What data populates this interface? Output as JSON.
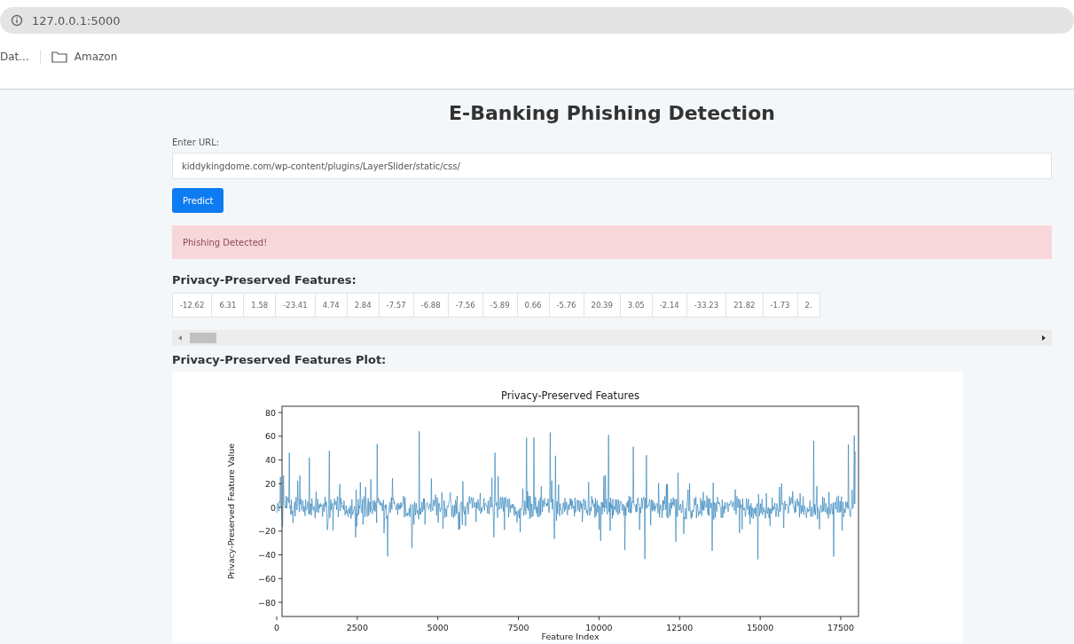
{
  "browser": {
    "address": "127.0.0.1:5000",
    "bookmarks": [
      {
        "label": "Dat...",
        "kind": "text"
      },
      {
        "label": "Amazon",
        "kind": "folder"
      }
    ]
  },
  "page": {
    "title": "E-Banking Phishing Detection",
    "url_label": "Enter URL:",
    "url_value": "kiddykingdome.com/wp-content/plugins/LayerSlider/static/css/",
    "button": "Predict",
    "alert": "Phishing Detected!",
    "features_heading": "Privacy-Preserved Features:",
    "features": [
      "-12.62",
      "6.31",
      "1.58",
      "-23.41",
      "4.74",
      "2.84",
      "-7.57",
      "-6.88",
      "-7.56",
      "-5.89",
      "0.66",
      "-5.76",
      "20.39",
      "3.05",
      "-2.14",
      "-33.23",
      "21.82",
      "-1.73",
      "2."
    ],
    "plot_heading": "Privacy-Preserved Features Plot:",
    "plot": {
      "title": "Privacy-Preserved Features",
      "xlabel": "Feature Index",
      "ylabel": "Privacy-Preserved Feature Value",
      "xticks": [
        "0",
        "2500",
        "5000",
        "7500",
        "10000",
        "12500",
        "15000",
        "17500"
      ],
      "yticks": [
        "80",
        "60",
        "40",
        "20",
        "0",
        "−20",
        "−40",
        "−60",
        "−80"
      ]
    }
  }
}
